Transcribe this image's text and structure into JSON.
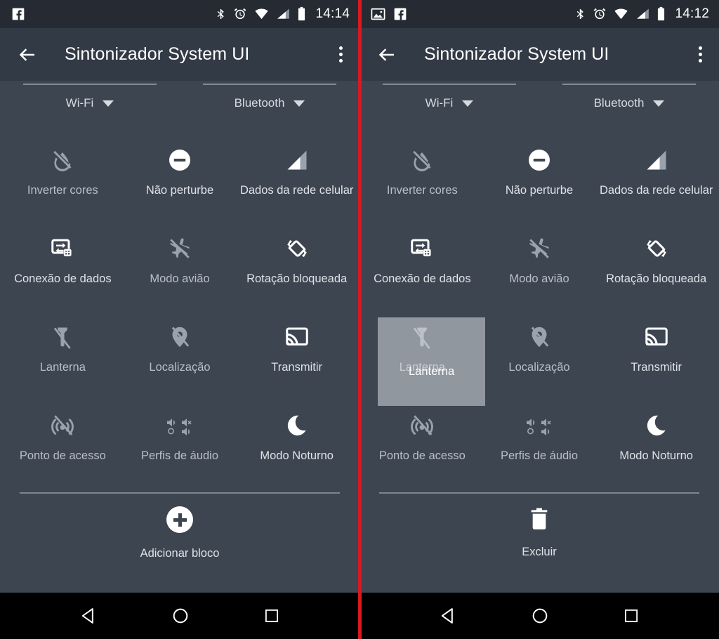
{
  "accent_colors": {
    "panel_background": "#3d4551",
    "appbar_background": "#323a45",
    "statusbar_background": "#262b33",
    "navbar_background": "#000000",
    "panel_divider_red": "#d71920",
    "tile_label": "#dfe3e7",
    "drag_highlight": "rgba(215,219,224,0.55)"
  },
  "panels": [
    {
      "id": "left",
      "statusbar": {
        "left_icons": [
          "facebook-icon"
        ],
        "right_icons": [
          "bluetooth-icon",
          "alarm-icon",
          "wifi-icon",
          "cell-signal-icon",
          "battery-icon"
        ],
        "clock": "14:14"
      },
      "appbar": {
        "back_icon": "back-arrow-icon",
        "title": "Sintonizador System UI",
        "overflow_icon": "overflow-menu-icon"
      },
      "toggles": [
        {
          "label": "Wi-Fi",
          "icon": "chevron-down-icon"
        },
        {
          "label": "Bluetooth",
          "icon": "chevron-down-icon"
        }
      ],
      "tiles": [
        {
          "label": "Inverter cores",
          "icon": "invert-colors-off-icon",
          "state": "off"
        },
        {
          "label": "Não perturbe",
          "icon": "do-not-disturb-icon",
          "state": "on"
        },
        {
          "label": "Dados da rede celular",
          "icon": "cellular-data-icon",
          "state": "on"
        },
        {
          "label": "Conexão de dados",
          "icon": "data-connection-icon",
          "state": "on"
        },
        {
          "label": "Modo avião",
          "icon": "airplane-off-icon",
          "state": "off"
        },
        {
          "label": "Rotação bloqueada",
          "icon": "rotation-lock-icon",
          "state": "on"
        },
        {
          "label": "Lanterna",
          "icon": "flashlight-off-icon",
          "state": "off"
        },
        {
          "label": "Localização",
          "icon": "location-off-icon",
          "state": "off"
        },
        {
          "label": "Transmitir",
          "icon": "cast-icon",
          "state": "on"
        },
        {
          "label": "Ponto de acesso",
          "icon": "hotspot-off-icon",
          "state": "off"
        },
        {
          "label": "Perfis de áudio",
          "icon": "audio-profiles-icon",
          "state": "off"
        },
        {
          "label": "Modo Noturno",
          "icon": "night-mode-icon",
          "state": "on"
        }
      ],
      "footer": {
        "label": "Adicionar bloco",
        "icon": "add-plus-icon"
      },
      "drag": null
    },
    {
      "id": "right",
      "statusbar": {
        "left_icons": [
          "screenshot-image-icon",
          "facebook-icon"
        ],
        "right_icons": [
          "bluetooth-icon",
          "alarm-icon",
          "wifi-icon",
          "cell-signal-icon",
          "battery-icon"
        ],
        "clock": "14:12"
      },
      "appbar": {
        "back_icon": "back-arrow-icon",
        "title": "Sintonizador System UI",
        "overflow_icon": "overflow-menu-icon"
      },
      "toggles": [
        {
          "label": "Wi-Fi",
          "icon": "chevron-down-icon"
        },
        {
          "label": "Bluetooth",
          "icon": "chevron-down-icon"
        }
      ],
      "tiles": [
        {
          "label": "Inverter cores",
          "icon": "invert-colors-off-icon",
          "state": "off"
        },
        {
          "label": "Não perturbe",
          "icon": "do-not-disturb-icon",
          "state": "on"
        },
        {
          "label": "Dados da rede celular",
          "icon": "cellular-data-icon",
          "state": "on"
        },
        {
          "label": "Conexão de dados",
          "icon": "data-connection-icon",
          "state": "on"
        },
        {
          "label": "Modo avião",
          "icon": "airplane-off-icon",
          "state": "off"
        },
        {
          "label": "Rotação bloqueada",
          "icon": "rotation-lock-icon",
          "state": "on"
        },
        {
          "label": "Lanterna",
          "icon": "flashlight-off-icon",
          "state": "off"
        },
        {
          "label": "Localização",
          "icon": "location-off-icon",
          "state": "off"
        },
        {
          "label": "Transmitir",
          "icon": "cast-icon",
          "state": "on"
        },
        {
          "label": "Ponto de acesso",
          "icon": "hotspot-off-icon",
          "state": "off"
        },
        {
          "label": "Perfis de áudio",
          "icon": "audio-profiles-icon",
          "state": "off"
        },
        {
          "label": "Modo Noturno",
          "icon": "night-mode-icon",
          "state": "on"
        }
      ],
      "footer": {
        "label": "Excluir",
        "icon": "trash-delete-icon"
      },
      "drag": {
        "label": "Lanterna",
        "active": true
      }
    }
  ],
  "navbar": {
    "buttons": [
      {
        "name": "back",
        "icon": "nav-back-triangle-icon"
      },
      {
        "name": "home",
        "icon": "nav-home-circle-icon"
      },
      {
        "name": "recents",
        "icon": "nav-recents-square-icon"
      }
    ]
  }
}
